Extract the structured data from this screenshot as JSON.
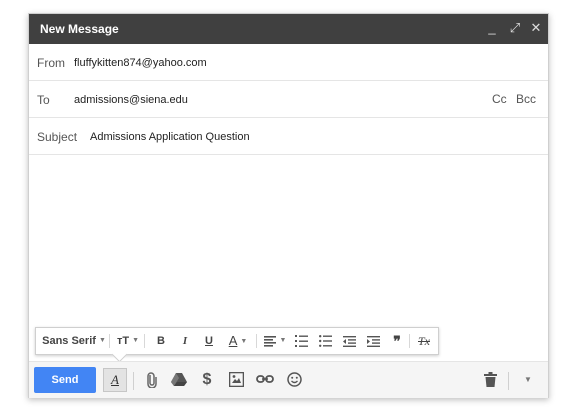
{
  "window": {
    "title": "New Message"
  },
  "controls": {
    "minimize": "_",
    "popout": "⤢",
    "close": "✕"
  },
  "from": {
    "label": "From",
    "value": "fluffykitten874@yahoo.com"
  },
  "to": {
    "label": "To",
    "value": "admissions@siena.edu",
    "cc": "Cc",
    "bcc": "Bcc"
  },
  "subject": {
    "label": "Subject",
    "value": "Admissions Application Question"
  },
  "formatting": {
    "font": "Sans Serif",
    "size_glyph": "тT",
    "bold": "B",
    "italic": "I",
    "underline": "U",
    "text_color": "A",
    "quote": "❞",
    "clear": "Tx"
  },
  "footer": {
    "send_label": "Send",
    "format_label": "A"
  },
  "colors": {
    "titlebar": "#404040",
    "send": "#4285f4"
  }
}
